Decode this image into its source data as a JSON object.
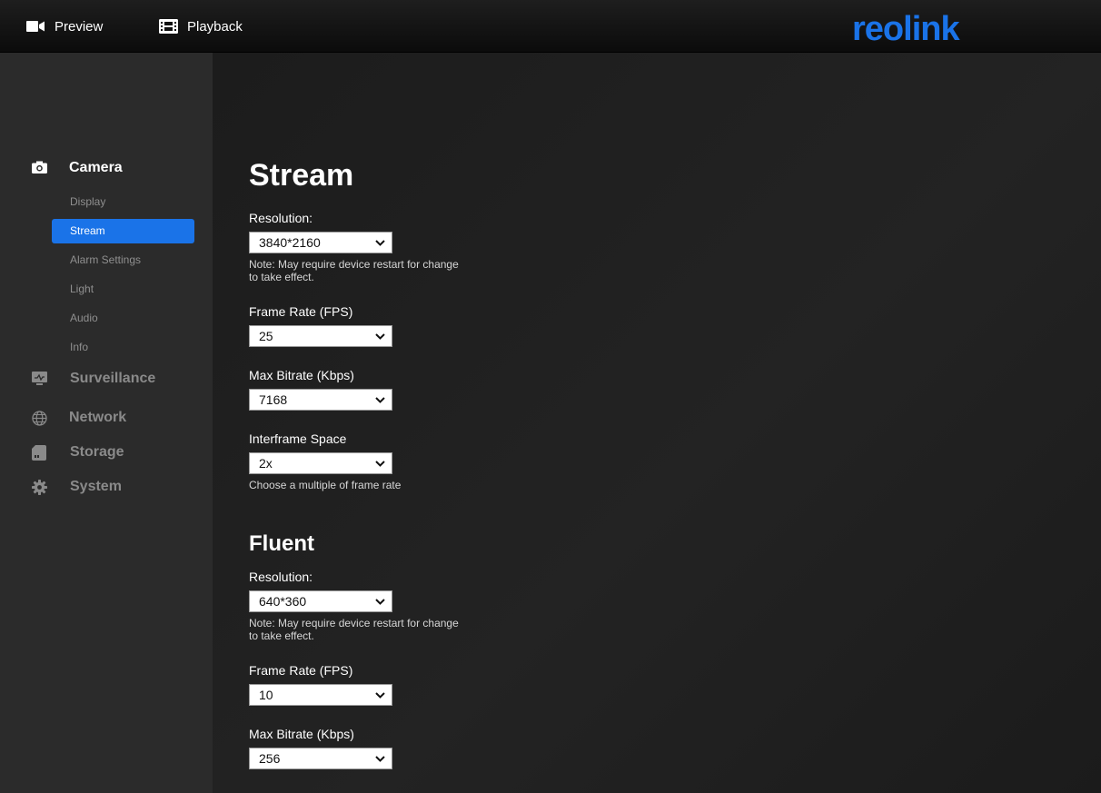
{
  "topbar": {
    "tabs": [
      {
        "label": "Preview",
        "icon": "video-camera-icon"
      },
      {
        "label": "Playback",
        "icon": "film-strip-icon"
      }
    ],
    "logo_text": "reolink",
    "logo_color": "#1a73e8"
  },
  "sidebar": {
    "categories": [
      {
        "label": "Camera",
        "icon": "camera-icon",
        "active": true
      },
      {
        "label": "Surveillance",
        "icon": "monitor-icon"
      },
      {
        "label": "Network",
        "icon": "globe-icon"
      },
      {
        "label": "Storage",
        "icon": "sd-card-icon"
      },
      {
        "label": "System",
        "icon": "gear-icon"
      }
    ],
    "camera_items": [
      "Display",
      "Stream",
      "Alarm Settings",
      "Light",
      "Audio",
      "Info"
    ],
    "selected_item": "Stream",
    "accent": "#1a73e8"
  },
  "stream": {
    "title": "Stream",
    "resolution_label": "Resolution:",
    "resolution_value": "3840*2160",
    "restart_note": "Note: May require device restart for change to take effect.",
    "frame_rate_label": "Frame Rate (FPS)",
    "frame_rate_value": "25",
    "max_bitrate_label": "Max Bitrate (Kbps)",
    "max_bitrate_value": "7168",
    "interframe_label": "Interframe Space",
    "interframe_value": "2x",
    "interframe_note": "Choose a multiple of frame rate"
  },
  "fluent": {
    "title": "Fluent",
    "resolution_label": "Resolution:",
    "resolution_value": "640*360",
    "restart_note": "Note: May require device restart for change to take effect.",
    "frame_rate_label": "Frame Rate (FPS)",
    "frame_rate_value": "10",
    "max_bitrate_label": "Max Bitrate (Kbps)",
    "max_bitrate_value": "256"
  }
}
